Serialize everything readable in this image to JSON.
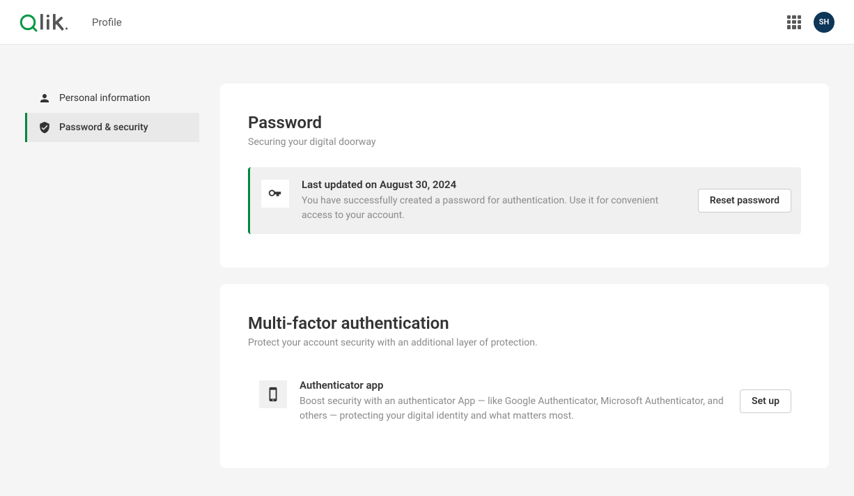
{
  "header": {
    "area_label": "Profile",
    "avatar_initials": "SH"
  },
  "sidebar": {
    "items": [
      {
        "label": "Personal information"
      },
      {
        "label": "Password & security"
      }
    ],
    "active_index": 1
  },
  "password_section": {
    "title": "Password",
    "subtitle": "Securing your digital doorway",
    "status_title": "Last updated on August 30, 2024",
    "status_desc": "You have successfully created a password for authentication. Use it for convenient access to your account.",
    "button": "Reset password"
  },
  "mfa_section": {
    "title": "Multi-factor authentication",
    "subtitle": "Protect your account security with an additional layer of protection.",
    "method_title": "Authenticator app",
    "method_desc": "Boost security with an authenticator App — like Google Authenticator, Microsoft Authenticator, and others — protecting your digital identity and what matters most.",
    "button": "Set up"
  }
}
